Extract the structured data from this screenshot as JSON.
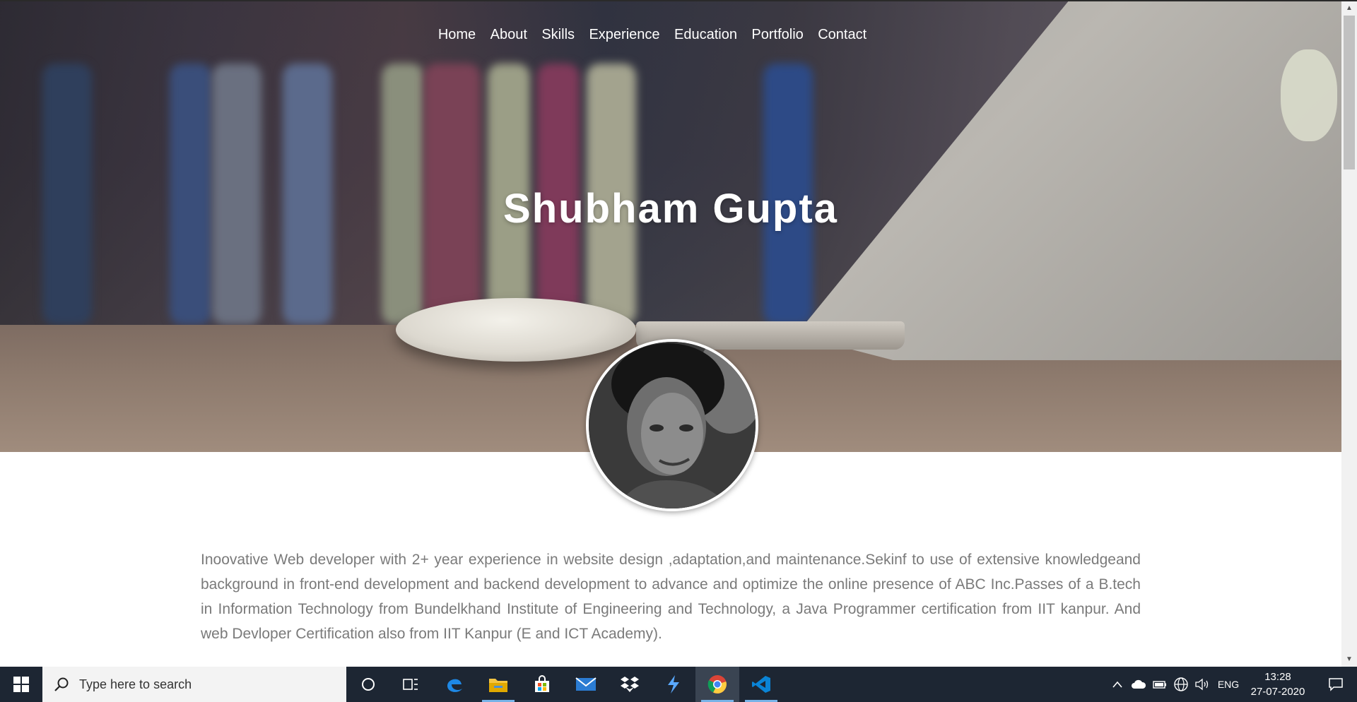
{
  "nav": {
    "items": [
      "Home",
      "About",
      "Skills",
      "Experience",
      "Education",
      "Portfolio",
      "Contact"
    ]
  },
  "hero": {
    "name": "Shubham Gupta"
  },
  "bio": {
    "text": "Inoovative Web developer with 2+ year experience in website design ,adaptation,and maintenance.Sekinf to use of extensive knowledgeand background in front-end development and backend development to advance and optimize the online presence of ABC Inc.Passes of a B.tech in Information Technology from Bundelkhand Institute of Engineering and Technology, a Java Programmer certification from IIT kanpur. And web Devloper Certification also from IIT Kanpur (E and ICT Academy)."
  },
  "taskbar": {
    "search_placeholder": "Type here to search",
    "language": "ENG",
    "time": "13:28",
    "date": "27-07-2020",
    "apps": [
      "cortana-icon",
      "task-view-icon",
      "edge-icon",
      "file-explorer-icon",
      "store-icon",
      "mail-icon",
      "dropbox-icon",
      "vs-app-icon",
      "chrome-icon",
      "vscode-icon"
    ],
    "active_app": "chrome-icon",
    "accent": "#1d2633"
  },
  "colors": {
    "bio_text": "#7a7a7a",
    "nav_text": "#ffffff"
  }
}
